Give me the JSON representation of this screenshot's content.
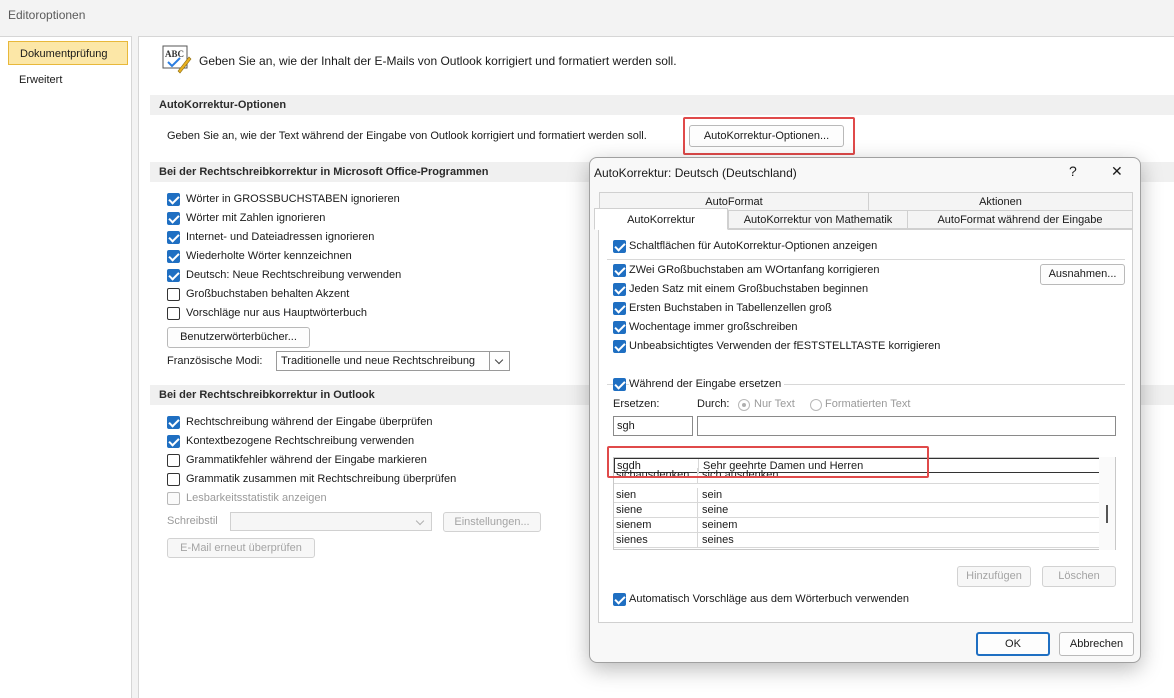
{
  "window": {
    "title": "Editoroptionen"
  },
  "sidebar": {
    "items": [
      {
        "label": "Dokumentprüfung"
      },
      {
        "label": "Erweitert"
      }
    ]
  },
  "main": {
    "intro": "Geben Sie an, wie der Inhalt der E-Mails von Outlook korrigiert und formatiert werden soll.",
    "autocorrect_section": {
      "title": "AutoKorrektur-Optionen",
      "description": "Geben Sie an, wie der Text während der Eingabe von Outlook korrigiert und formatiert werden soll.",
      "button": "AutoKorrektur-Optionen..."
    },
    "office_section": {
      "title": "Bei der Rechtschreibkorrektur in Microsoft Office-Programmen",
      "options": [
        {
          "label": "Wörter in GROSSBUCHSTABEN ignorieren",
          "checked": true
        },
        {
          "label": "Wörter mit Zahlen ignorieren",
          "checked": true
        },
        {
          "label": "Internet- und Dateiadressen ignorieren",
          "checked": true
        },
        {
          "label": "Wiederholte Wörter kennzeichnen",
          "checked": true
        },
        {
          "label": "Deutsch: Neue Rechtschreibung verwenden",
          "checked": true
        },
        {
          "label": "Großbuchstaben behalten Akzent",
          "checked": false
        },
        {
          "label": "Vorschläge nur aus Hauptwörterbuch",
          "checked": false
        }
      ],
      "dictionaries_button": "Benutzerwörterbücher...",
      "french_label": "Französische Modi:",
      "french_value": "Traditionelle und neue Rechtschreibung"
    },
    "outlook_section": {
      "title": "Bei der Rechtschreibkorrektur in Outlook",
      "options": [
        {
          "label": "Rechtschreibung während der Eingabe überprüfen",
          "checked": true
        },
        {
          "label": "Kontextbezogene Rechtschreibung verwenden",
          "checked": true
        },
        {
          "label": "Grammatikfehler während der Eingabe markieren",
          "checked": false
        },
        {
          "label": "Grammatik zusammen mit Rechtschreibung überprüfen",
          "checked": false
        },
        {
          "label": "Lesbarkeitsstatistik anzeigen",
          "checked": false,
          "disabled": true
        }
      ],
      "writing_style_label": "Schreibstil",
      "writing_style_value": "",
      "settings_button": "Einstellungen...",
      "recheck_button": "E-Mail erneut überprüfen"
    }
  },
  "dialog": {
    "title": "AutoKorrektur: Deutsch (Deutschland)",
    "help": "?",
    "close": "✕",
    "tabs_top": [
      {
        "label": "AutoFormat"
      },
      {
        "label": "Aktionen"
      }
    ],
    "tabs_bottom": [
      {
        "label": "AutoKorrektur",
        "active": true
      },
      {
        "label": "AutoKorrektur von Mathematik"
      },
      {
        "label": "AutoFormat während der Eingabe"
      }
    ],
    "show_buttons": {
      "label": "Schaltflächen für AutoKorrektur-Optionen anzeigen",
      "checked": true
    },
    "options": [
      {
        "label": "ZWei GRoßbuchstaben am WOrtanfang korrigieren",
        "checked": true
      },
      {
        "label": "Jeden Satz mit einem Großbuchstaben beginnen",
        "checked": true
      },
      {
        "label": "Ersten Buchstaben in Tabellenzellen groß",
        "checked": true
      },
      {
        "label": "Wochentage immer großschreiben",
        "checked": true
      },
      {
        "label": "Unbeabsichtigtes Verwenden der fESTSTELLTASTE korrigieren",
        "checked": true
      }
    ],
    "exceptions_button": "Ausnahmen...",
    "replace_while_typing": {
      "label": "Während der Eingabe ersetzen",
      "checked": true
    },
    "replace_label": "Ersetzen:",
    "with_label": "Durch:",
    "radio_plain": "Nur Text",
    "radio_formatted": "Formatierten Text",
    "replace_value": "sgh",
    "with_value": "",
    "entries": [
      {
        "from": "sgdh",
        "to": "Sehr geehrte Damen und Herren"
      },
      {
        "from": "sichausdenken",
        "to": "sich ausdenken"
      },
      {
        "from": "sien",
        "to": "sein"
      },
      {
        "from": "siene",
        "to": "seine"
      },
      {
        "from": "sienem",
        "to": "seinem"
      },
      {
        "from": "sienes",
        "to": "seines"
      }
    ],
    "add_button": "Hinzufügen",
    "delete_button": "Löschen",
    "dictionary_suggestions": {
      "label": "Automatisch Vorschläge aus dem Wörterbuch verwenden",
      "checked": true
    },
    "ok_button": "OK",
    "cancel_button": "Abbrechen"
  }
}
